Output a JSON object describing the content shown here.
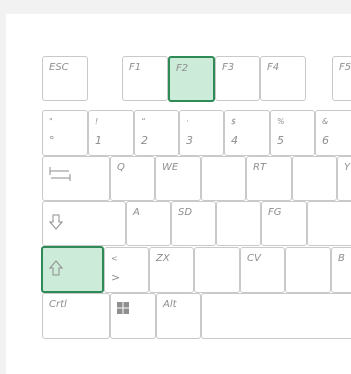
{
  "keyboard": {
    "fn_row": {
      "esc": "ESC",
      "f1": "F1",
      "f2": "F2",
      "f3": "F3",
      "f4": "F4",
      "f5": "F5"
    },
    "number_row": [
      {
        "top": "\"",
        "bottom": "°"
      },
      {
        "top": "!",
        "bottom": "1"
      },
      {
        "top": "“",
        "bottom": "2"
      },
      {
        "top": "·",
        "bottom": "3"
      },
      {
        "top": "$",
        "bottom": "4"
      },
      {
        "top": "%",
        "bottom": "5"
      },
      {
        "top": "&",
        "bottom": "6"
      }
    ],
    "tab_row": {
      "q": "Q",
      "we": "WE",
      "rt": "RT",
      "y": "Y"
    },
    "home_row": {
      "a": "A",
      "sd": "SD",
      "fg": "FG"
    },
    "shift_row": {
      "angle_top": "<",
      "angle_bottom": ">",
      "zx": "ZX",
      "cv": "CV",
      "b": "B"
    },
    "bottom_row": {
      "ctrl": "Crtl",
      "alt": "Alt"
    },
    "highlight_color": "#cdebd9",
    "active_keys": [
      "F2",
      "Left Shift"
    ]
  }
}
